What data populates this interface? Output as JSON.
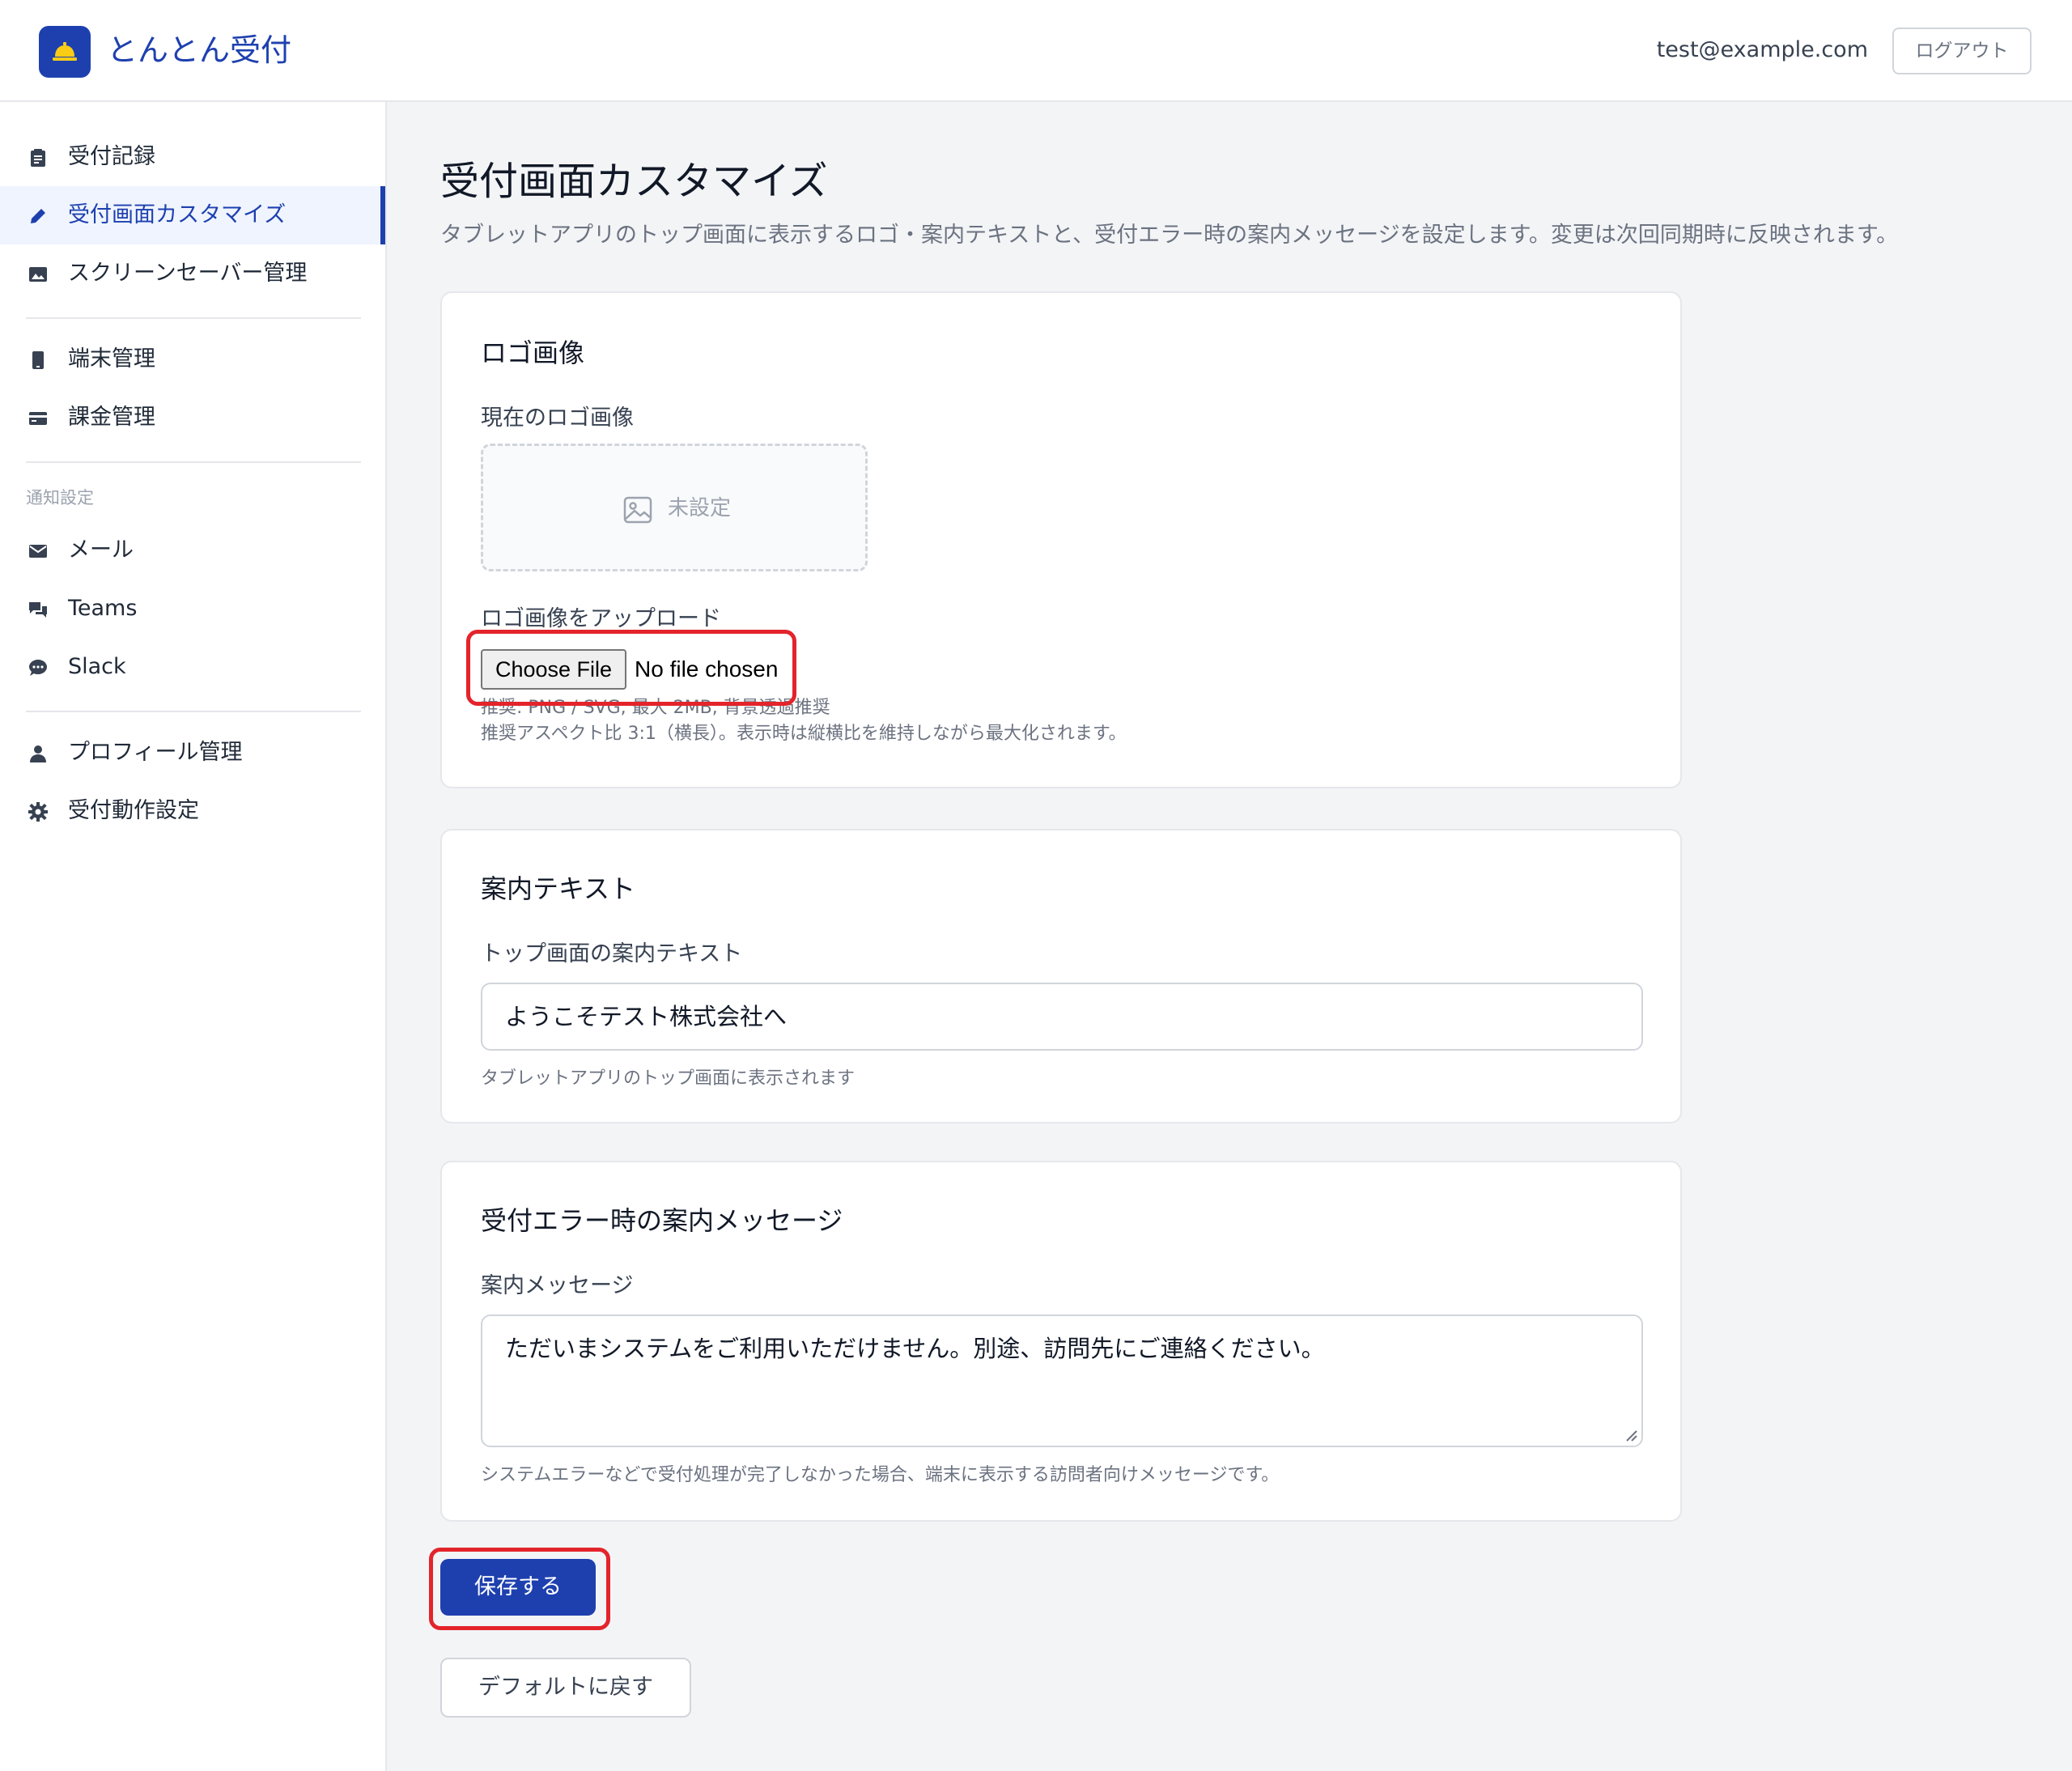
{
  "header": {
    "app_name": "とんとん受付",
    "logo_icon": "bell-icon",
    "user_email": "test@example.com",
    "logout_label": "ログアウト"
  },
  "sidebar": {
    "items": [
      {
        "label": "受付記録",
        "icon": "clipboard-icon"
      },
      {
        "label": "受付画面カスタマイズ",
        "icon": "pencil-icon",
        "active": true
      },
      {
        "label": "スクリーンセーバー管理",
        "icon": "image-icon"
      },
      {
        "label": "端末管理",
        "icon": "tablet-icon"
      },
      {
        "label": "課金管理",
        "icon": "credit-card-icon"
      },
      {
        "label": "メール",
        "icon": "envelope-icon"
      },
      {
        "label": "Teams",
        "icon": "chat-icon"
      },
      {
        "label": "Slack",
        "icon": "speech-bubble-icon"
      },
      {
        "label": "プロフィール管理",
        "icon": "user-icon"
      },
      {
        "label": "受付動作設定",
        "icon": "gear-icon"
      }
    ],
    "section_notifications": "通知設定"
  },
  "main": {
    "title": "受付画面カスタマイズ",
    "description": "タブレットアプリのトップ画面に表示するロゴ・案内テキストと、受付エラー時の案内メッセージを設定します。変更は次回同期時に反映されます。",
    "logo_card": {
      "title": "ロゴ画像",
      "current_label": "現在のロゴ画像",
      "placeholder_text": "未設定",
      "upload_label": "ロゴ画像をアップロード",
      "choose_file_label": "Choose File",
      "no_file_text": "No file chosen",
      "help_line1": "推奨: PNG / SVG, 最大 2MB, 背景透過推奨",
      "help_line2": "推奨アスペクト比 3:1（横長）。表示時は縦横比を維持しながら最大化されます。"
    },
    "guide_card": {
      "title": "案内テキスト",
      "field_label": "トップ画面の案内テキスト",
      "value": "ようこそテスト株式会社へ",
      "help": "タブレットアプリのトップ画面に表示されます"
    },
    "error_card": {
      "title": "受付エラー時の案内メッセージ",
      "field_label": "案内メッセージ",
      "value": "ただいまシステムをご利用いただけません。別途、訪問先にご連絡ください。",
      "help": "システムエラーなどで受付処理が完了しなかった場合、端末に表示する訪問者向けメッセージです。"
    },
    "save_label": "保存する",
    "reset_label": "デフォルトに戻す"
  },
  "colors": {
    "accent": "#1e40af",
    "highlight": "#e3242b"
  }
}
